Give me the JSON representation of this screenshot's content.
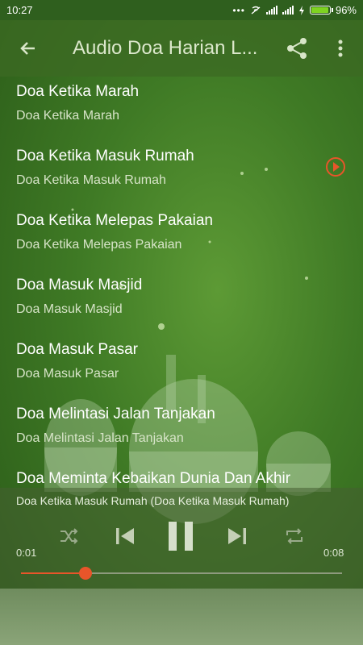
{
  "status_bar": {
    "time": "10:27",
    "battery": "96%"
  },
  "app_bar": {
    "title": "Audio Doa Harian L..."
  },
  "list": {
    "items": [
      {
        "title": "Doa Ketika Marah",
        "subtitle": "Doa Ketika Marah"
      },
      {
        "title": "Doa Ketika Masuk Rumah",
        "subtitle": "Doa Ketika Masuk Rumah"
      },
      {
        "title": "Doa Ketika Melepas Pakaian",
        "subtitle": "Doa Ketika Melepas Pakaian"
      },
      {
        "title": "Doa Masuk Masjid",
        "subtitle": "Doa Masuk Masjid"
      },
      {
        "title": "Doa Masuk Pasar",
        "subtitle": "Doa Masuk Pasar"
      },
      {
        "title": "Doa Melintasi Jalan Tanjakan",
        "subtitle": "Doa Melintasi Jalan Tanjakan"
      },
      {
        "title": "Doa Meminta Kebaikan Dunia Dan Akhir",
        "subtitle": ""
      }
    ],
    "playing_index": 1
  },
  "player": {
    "now_playing": "Doa Ketika Masuk Rumah (Doa Ketika Masuk Rumah)",
    "elapsed": "0:01",
    "duration": "0:08",
    "progress_fraction": 0.2
  },
  "colors": {
    "accent": "#e8552a",
    "appbar": "#3c6923",
    "background": "#3f7a25"
  },
  "icons": [
    "back-arrow-icon",
    "share-icon",
    "more-vert-icon",
    "play-circle-icon",
    "shuffle-icon",
    "skip-previous-icon",
    "pause-icon",
    "skip-next-icon",
    "repeat-icon",
    "battery-icon",
    "signal-icon",
    "wifi-icon"
  ]
}
